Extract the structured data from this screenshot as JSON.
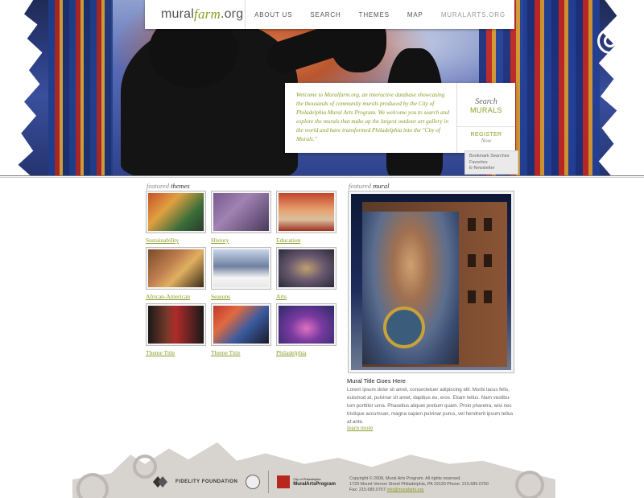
{
  "nav": {
    "logo": {
      "brand_a": "mural",
      "brand_b": "farm",
      "brand_c": ".org"
    },
    "items": [
      {
        "label": "ABOUT US"
      },
      {
        "label": "SEARCH"
      },
      {
        "label": "THEMES"
      },
      {
        "label": "MAP"
      },
      {
        "label": "MURALARTS.ORG"
      }
    ]
  },
  "welcome": {
    "text": "Welcome to Muralfarm.org, an interactive database showcasing the thousands of community murals produced by the City of Philadelphia Mural Arts Program. We welcome you to search and explore the murals that make up the largest outdoor art gallery in the world and have transformed Philadelphia into the \"City of Murals.\"",
    "search_line1": "Search",
    "search_line2": "MURALS",
    "register_line1": "REGISTER",
    "register_line2": "Now",
    "links": [
      "Bookmark Searches",
      "Favorites",
      "E-Newsletter"
    ]
  },
  "themes": {
    "title_prefix": "featured",
    "title_suffix": "themes",
    "items": [
      {
        "label": "Sustainability"
      },
      {
        "label": "History"
      },
      {
        "label": "Education"
      },
      {
        "label": "African-American"
      },
      {
        "label": "Seasons"
      },
      {
        "label": "Arts"
      },
      {
        "label": "Theme Title"
      },
      {
        "label": "Theme Title"
      },
      {
        "label": "Philadelphia"
      }
    ]
  },
  "mural": {
    "title_prefix": "featured",
    "title_suffix": "mural",
    "name": "Mural Title Goes Here",
    "description": "Lorem ipsum dolor sit amet, consectetuer adipiscing elit. Morbi lacus felis, euismod at, pulvinar sit amet, dapibus eu, eros. Etiam tellus. Nam vestibu-lum porttitor urna. Phasellus aliquet pretium quam. Proin pharetra, wisi nec tristique accumsan, magna sapien pulvinar purus, vel hendrerit ipsum tellus at ante.",
    "learn_more": "learn more"
  },
  "footer": {
    "fidelity": "FIDELITY FOUNDATION",
    "map_top": "City of Philadelphia",
    "map_bottom": "MuralArtsProgram",
    "copyright_line1": "Copyright © 2008, Mural Arts Program. All rights reserved.",
    "copyright_line2": "1729 Mount Vernon Street Philadelphia, PA 19130 Phone: 215.685.0750",
    "copyright_line3": "Fax: 215.685.0757",
    "email": "info@muralarts.org"
  },
  "colors": {
    "accent": "#8a9b24",
    "hero_blue": "#2d3f86",
    "footer_gray": "#d7d3cf"
  }
}
